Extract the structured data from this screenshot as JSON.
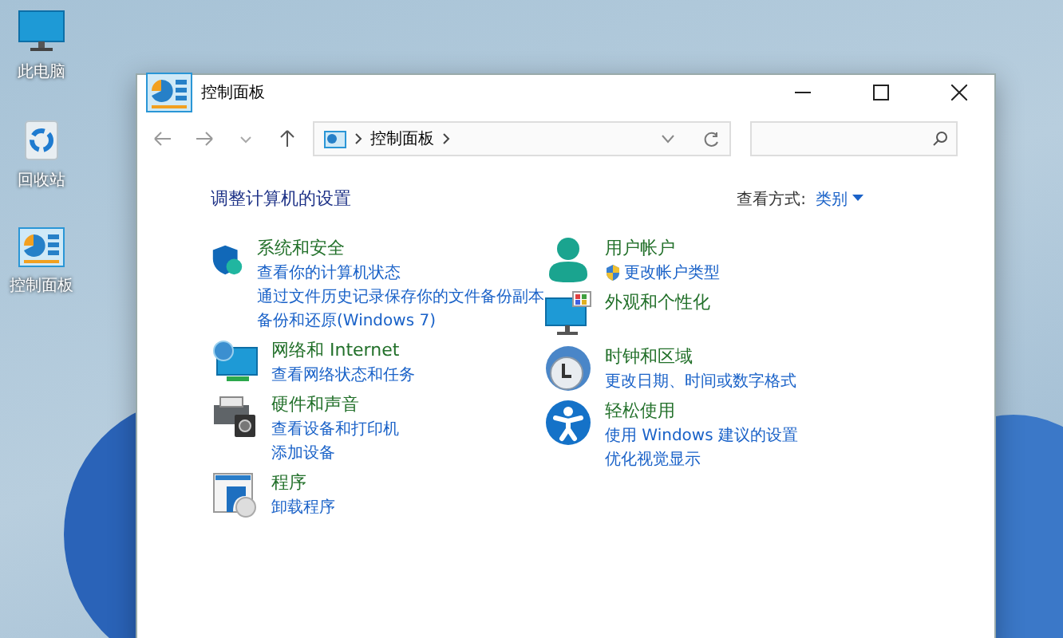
{
  "desktop_icons": [
    {
      "label": "此电脑"
    },
    {
      "label": "回收站"
    },
    {
      "label": "控制面板"
    }
  ],
  "window": {
    "title": "控制面板"
  },
  "address_bar": {
    "segments": [
      "控制面板"
    ]
  },
  "heading": "调整计算机的设置",
  "view_by": {
    "label": "查看方式:",
    "value": "类别"
  },
  "columns": [
    [
      {
        "title": "系统和安全",
        "links": [
          {
            "text": "查看你的计算机状态",
            "shield": false
          },
          {
            "text": "通过文件历史记录保存你的文件备份副本",
            "shield": false
          },
          {
            "text": "备份和还原(Windows 7)",
            "shield": false
          }
        ]
      },
      {
        "title": "网络和 Internet",
        "links": [
          {
            "text": "查看网络状态和任务",
            "shield": false
          }
        ]
      },
      {
        "title": "硬件和声音",
        "links": [
          {
            "text": "查看设备和打印机",
            "shield": false
          },
          {
            "text": "添加设备",
            "shield": false
          }
        ]
      },
      {
        "title": "程序",
        "links": [
          {
            "text": "卸载程序",
            "shield": false
          }
        ]
      }
    ],
    [
      {
        "title": "用户帐户",
        "links": [
          {
            "text": "更改帐户类型",
            "shield": true
          }
        ]
      },
      {
        "title": "外观和个性化"
      },
      {
        "title": "时钟和区域",
        "links": [
          {
            "text": "更改日期、时间或数字格式",
            "shield": false
          }
        ]
      },
      {
        "title": "轻松使用",
        "links": [
          {
            "text": "使用 Windows 建议的设置",
            "shield": false
          },
          {
            "text": "优化视觉显示",
            "shield": false
          }
        ]
      }
    ]
  ]
}
